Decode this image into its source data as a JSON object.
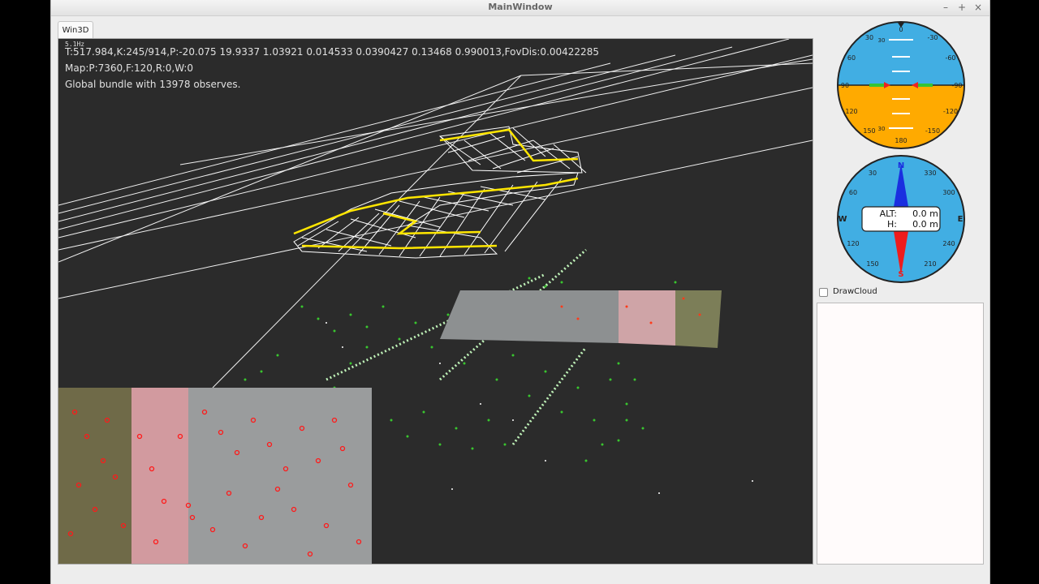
{
  "window": {
    "title": "MainWindow",
    "minimize_glyph": "–",
    "maximize_glyph": "+",
    "close_glyph": "×"
  },
  "tabs": [
    {
      "label": "Win3D",
      "active": true
    }
  ],
  "viewport": {
    "rate": "5.1Hz",
    "info_lines": [
      "T:517.984,K:245/914,P:-20.075 19.9337 1.03921 0.014533 0.0390427 0.13468 0.990013,FovDis:0.00422285",
      "Map:P:7360,F:120,R:0,W:0",
      "Global bundle with 13978 observes."
    ]
  },
  "attitude_indicator": {
    "roll_deg": 0,
    "pitch_deg": 0,
    "sky_color": "#41aee3",
    "ground_color": "#ffaa00",
    "scale_labels": [
      "0",
      "30",
      "60",
      "90",
      "120",
      "150",
      "180",
      "-150",
      "-120",
      "-90",
      "-60",
      "-30"
    ],
    "pitch_labels": [
      "30",
      "30"
    ]
  },
  "compass": {
    "heading_deg": 0,
    "face_color": "#41aee3",
    "cardinals": [
      "N",
      "E",
      "S",
      "W"
    ],
    "scale_labels": [
      "30",
      "60",
      "120",
      "150",
      "210",
      "240",
      "300",
      "330"
    ],
    "alt_label": "ALT:",
    "alt_value": "0.0 m",
    "h_label": "H:",
    "h_value": "0.0 m"
  },
  "draw_cloud": {
    "label": "DrawCloud",
    "checked": false
  },
  "colors": {
    "keyframe_edges": "#ffffff",
    "trajectory": "#ffe600",
    "map_points": "#39c62f",
    "feature_points": "#ff0000"
  }
}
